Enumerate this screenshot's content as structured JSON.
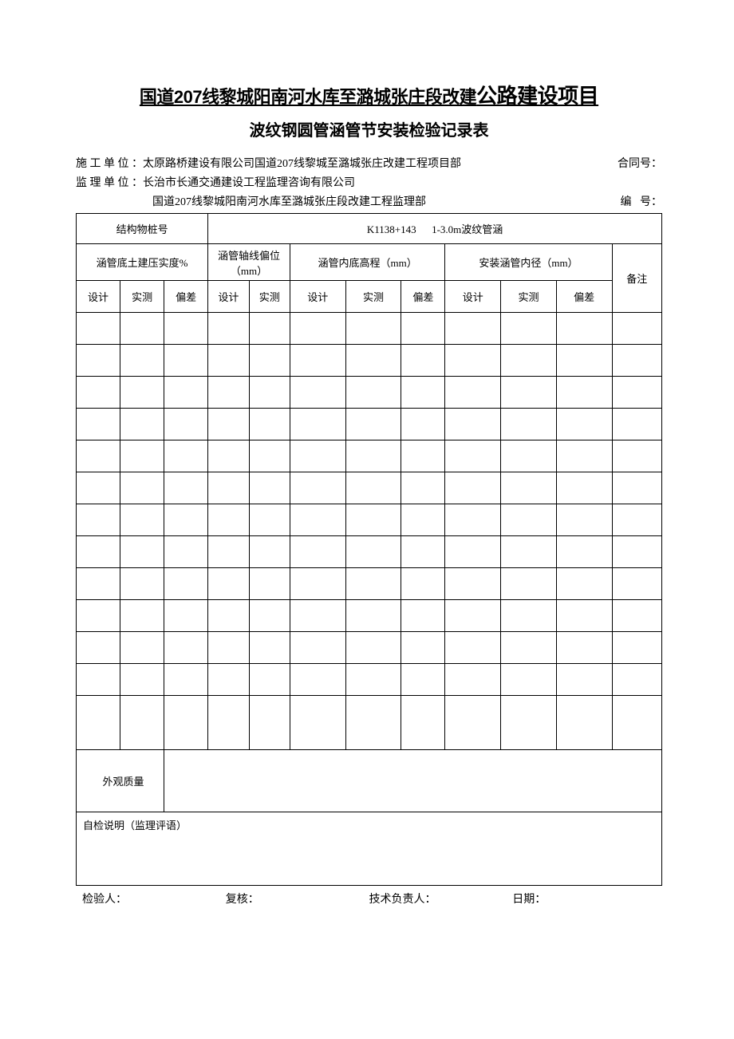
{
  "title": {
    "line1_part1": "国道207线黎城阳南河水库至潞城张庄段改建",
    "line1_part2": "公路建设项目",
    "line2": "波纹钢圆管涵管节安装检验记录表"
  },
  "meta": {
    "construction_label": "施 工 单 位 ：",
    "construction_value": " 太原路桥建设有限公司国道207线黎城至潞城张庄改建工程项目部",
    "contract_label": "合同号：",
    "supervision_label": "监 理 单 位 ：",
    "supervision_value": "长治市长通交通建设工程监理咨询有限公司",
    "supervision_line2": "国道207线黎城阳南河水库至潞城张庄段改建工程监理部",
    "code_label": "编   号："
  },
  "table": {
    "structure_pile_label": "结构物桩号",
    "structure_pile_value": "K1138+143      1-3.0m波纹管涵",
    "group1": "涵管底土建压实度%",
    "group2": "涵管轴线偏位（mm）",
    "group3": "涵管内底高程（mm）",
    "group4": "安装涵管内径（mm）",
    "remark": "备注",
    "col_design": "设计",
    "col_measured": "实测",
    "col_deviation": "偏差",
    "appearance_label": "外观质量",
    "comment_label": "自检说明（监理评语）"
  },
  "footer": {
    "inspector": "检验人：",
    "reviewer": "复核：",
    "tech_lead": "技术负责人：",
    "date": "日期："
  }
}
